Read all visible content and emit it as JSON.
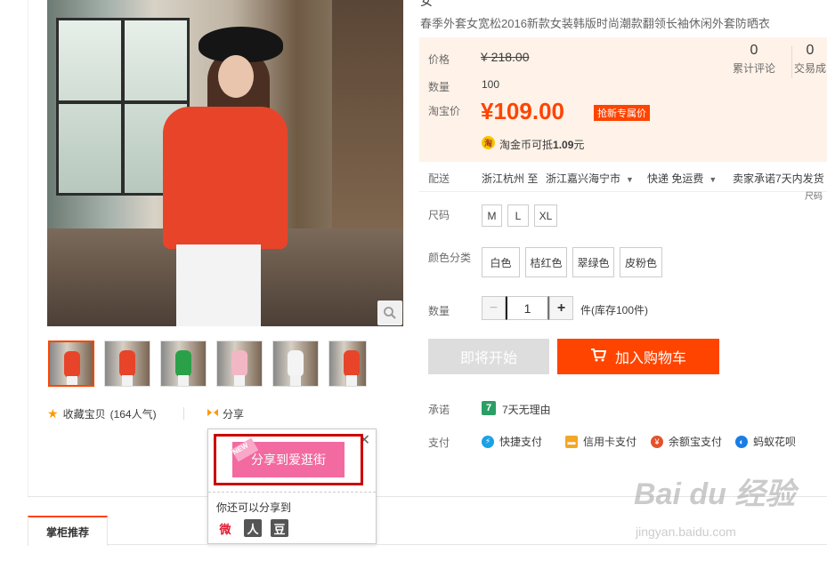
{
  "product": {
    "title_top": "女",
    "title": "春季外套女宽松2016新款女装韩版时尚潮款翻领长袖休闲外套防晒衣"
  },
  "price": {
    "label": "价格",
    "original": "¥ 218.00",
    "qty_label": "数量",
    "qty_value": "100",
    "tb_label": "淘宝价",
    "tb_price": "¥109.00",
    "promo_tag": "抢新专属价",
    "coin_icon": "淘",
    "coin_text": "淘金币可抵",
    "coin_value": "1.09",
    "coin_unit": "元"
  },
  "stats": [
    {
      "num": "0",
      "label": "累计评论"
    },
    {
      "num": "0",
      "label": "交易成"
    }
  ],
  "shipping": {
    "label": "配送",
    "from": "浙江杭州 至",
    "to": "浙江嘉兴海宁市",
    "method": "快递 免运费",
    "promise": "卖家承诺7天内发货",
    "note": "尺码"
  },
  "size": {
    "label": "尺码",
    "options": [
      "M",
      "L",
      "XL"
    ]
  },
  "color": {
    "label": "颜色分类",
    "options": [
      "白色",
      "桔红色",
      "翠绿色",
      "皮粉色"
    ]
  },
  "quantity": {
    "label": "数量",
    "minus": "−",
    "plus": "+",
    "value": "1",
    "stock": "件(库存100件)"
  },
  "buttons": {
    "soon": "即将开始",
    "cart": "加入购物车"
  },
  "promise": {
    "label": "承诺",
    "icon": "7",
    "text": "7天无理由"
  },
  "payment": {
    "label": "支付",
    "methods": [
      "快捷支付",
      "信用卡支付",
      "余额宝支付",
      "蚂蚁花呗"
    ]
  },
  "gallery": {
    "zoom_icon": "search-icon",
    "collect": "收藏宝贝",
    "collect_count": "(164人气)",
    "share": "分享"
  },
  "share_popup": {
    "close": "✕",
    "new_tag": "NEW",
    "share_button": "分享到爱逛街",
    "sub_title": "你还可以分享到",
    "sites": [
      "微",
      "人",
      "豆"
    ]
  },
  "tabs": {
    "recommend": "掌柜推荐"
  },
  "watermark": {
    "main": "Bai du 经验",
    "sub": "jingyan.baidu.com"
  },
  "colors": {
    "accent": "#ff4400",
    "price_bg": "#fff2e8",
    "share_pink": "#f26aa0",
    "highlight_red": "#cc0000"
  }
}
